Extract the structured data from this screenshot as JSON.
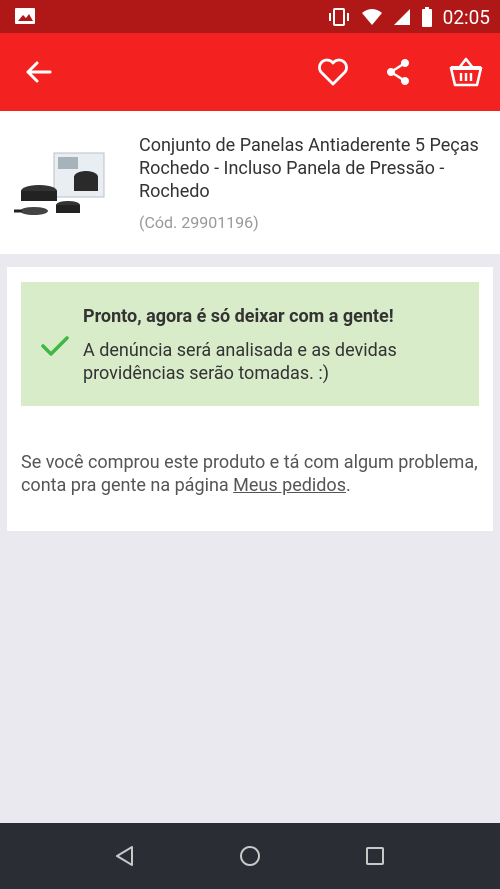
{
  "status_bar": {
    "time": "02:05"
  },
  "app_bar": {
    "icons": [
      "back-arrow-icon",
      "heart-icon",
      "share-icon",
      "basket-icon"
    ]
  },
  "product": {
    "title": "Conjunto de Panelas Antiaderente 5 Peças Rochedo - Incluso Panela de Pressão - Rochedo",
    "code": "(Cód. 29901196)"
  },
  "report": {
    "success_title": "Pronto, agora é só deixar com a gente!",
    "success_message": "A denúncia será analisada e as devidas providências serão tomadas. :)",
    "info_text": "Se você comprou este produto e tá com algum problema, conta pra gente na página ",
    "info_link": "Meus pedidos",
    "info_end": "."
  },
  "colors": {
    "status_bar": "#b01818",
    "app_bar": "#f42121",
    "success_bg": "#d9ecca",
    "check": "#3db843",
    "nav_bar": "#2a2d33"
  }
}
